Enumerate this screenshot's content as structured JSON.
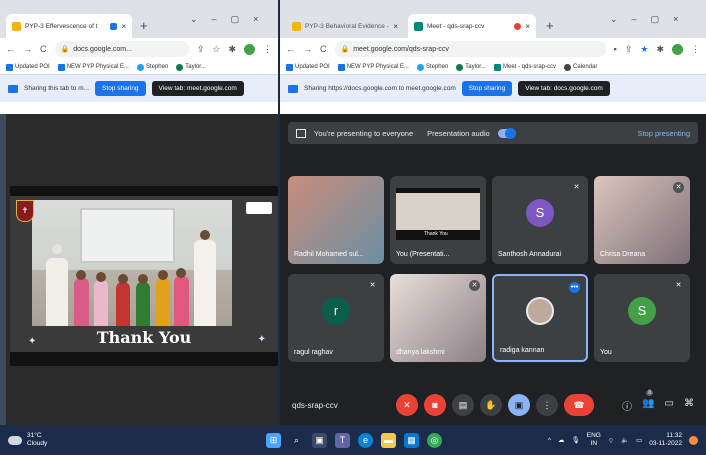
{
  "left_window": {
    "tab": {
      "title": "PYP-3 Effervescence of t",
      "close": "×"
    },
    "new_tab": "+",
    "window_controls": [
      "⌄",
      "–",
      "▢",
      "×"
    ],
    "address": "docs.google.com...",
    "bookmarks": [
      "Updated POI",
      "NEW PYP Physical E...",
      "Stephen",
      "Taylor..."
    ],
    "sharebar": {
      "text": "Sharing this tab to m...",
      "stop": "Stop sharing",
      "view": "View tab: meet.google.com"
    },
    "slide": {
      "thank_you": "Thank You"
    }
  },
  "right_window": {
    "tabs": [
      {
        "title": "PYP-3 Behavioral Evidence - Goo",
        "close": "×"
      },
      {
        "title": "Meet - qds-srap-ccv",
        "close": "×"
      }
    ],
    "new_tab": "+",
    "window_controls": [
      "⌄",
      "–",
      "▢",
      "×"
    ],
    "address": "meet.google.com/qds-srap-ccv",
    "bookmarks": [
      "Updated POI",
      "NEW PYP Physical E...",
      "Stephen",
      "Taylor...",
      "Meet - qds-srap-ccv",
      "Calendar"
    ],
    "sharebar": {
      "text": "Sharing https://docs.google.com to meet.google.com",
      "stop": "Stop sharing",
      "view": "View tab: docs.google.com"
    }
  },
  "meet": {
    "presenting": "You're presenting to everyone",
    "audio": "Presentation audio",
    "stop": "Stop presenting",
    "code": "qds-srap-ccv",
    "participants": [
      {
        "name": "Radhil Mohamed sul..."
      },
      {
        "name": "You (Presentati..."
      },
      {
        "name": "Santhosh Annadurai",
        "initial": "S",
        "color": "#7e57c2"
      },
      {
        "name": "Chrisa Dreana"
      },
      {
        "name": "ragul raghav",
        "initial": "r",
        "color": "#0b5e4a"
      },
      {
        "name": "dhanya lakshmi"
      },
      {
        "name": "radiga kannan"
      },
      {
        "name": "You",
        "initial": "S",
        "color": "#43a047"
      }
    ],
    "people_count": "8"
  },
  "taskbar": {
    "temp": "31°C",
    "weather": "Cloudy",
    "lang": "ENG",
    "region": "IN",
    "time": "11:32",
    "date": "03-11-2022"
  }
}
